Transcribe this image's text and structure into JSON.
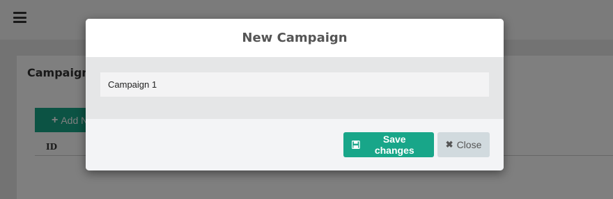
{
  "background": {
    "panel_title": "Campaign",
    "add_button": {
      "label": "Add N"
    },
    "table": {
      "columns": [
        "ID"
      ]
    }
  },
  "modal": {
    "title": "New Campaign",
    "input": {
      "value": "Campaign 1",
      "placeholder": ""
    },
    "save_label": "Save changes",
    "close_label": "Close"
  },
  "colors": {
    "primary": "#18a689",
    "close_button": "#d1dade",
    "modal_body": "#e5e6e7",
    "overlay": "rgba(0,0,0,0.5)"
  },
  "icons": {
    "menu": "hamburger-icon",
    "add": "plus-icon",
    "save": "floppy-disk-icon",
    "close": "x-icon"
  }
}
